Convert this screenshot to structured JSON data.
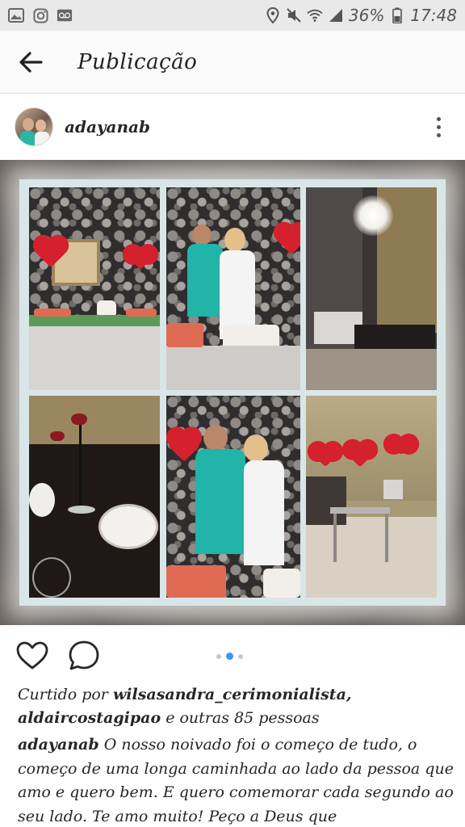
{
  "status_bar": {
    "battery": "36%",
    "time": "17:48",
    "left_icons": [
      "image-icon",
      "instagram-icon",
      "voicemail-icon"
    ],
    "right_icons": [
      "location-icon",
      "mute-icon",
      "wifi-icon",
      "signal-icon",
      "battery-icon"
    ]
  },
  "app_bar": {
    "title": "Publicação",
    "back_icon": "arrow-left-icon"
  },
  "post": {
    "username": "adayanab",
    "more_icon": "more-vertical-icon",
    "image": {
      "tiles": [
        "dessert-table",
        "couple-cutting-cake",
        "dining-room-chandelier",
        "table-setting-candelabra",
        "couple-embrace",
        "hall-with-heart-balloons"
      ]
    },
    "carousel": {
      "count": 3,
      "active_index": 1
    },
    "actions": {
      "like_icon": "heart-outline-icon",
      "comment_icon": "comment-outline-icon"
    },
    "likes": {
      "prefix": "Curtido por ",
      "user1": "wilsasandra_cerimonialista,",
      "user2": "aldaircostagipao",
      "suffix": " e outras 85 pessoas"
    },
    "caption": {
      "username": "adayanab",
      "text": " O nosso noivado foi o começo de tudo, o começo de uma longa caminhada ao lado da pessoa que amo e quero bem. E quero comemorar cada segundo ao seu lado. Te amo muito! Peço a Deus que"
    }
  },
  "colors": {
    "accent": "#3897f0",
    "heart_red": "#d5202e",
    "status_bar_bg": "#e9e9e9"
  }
}
